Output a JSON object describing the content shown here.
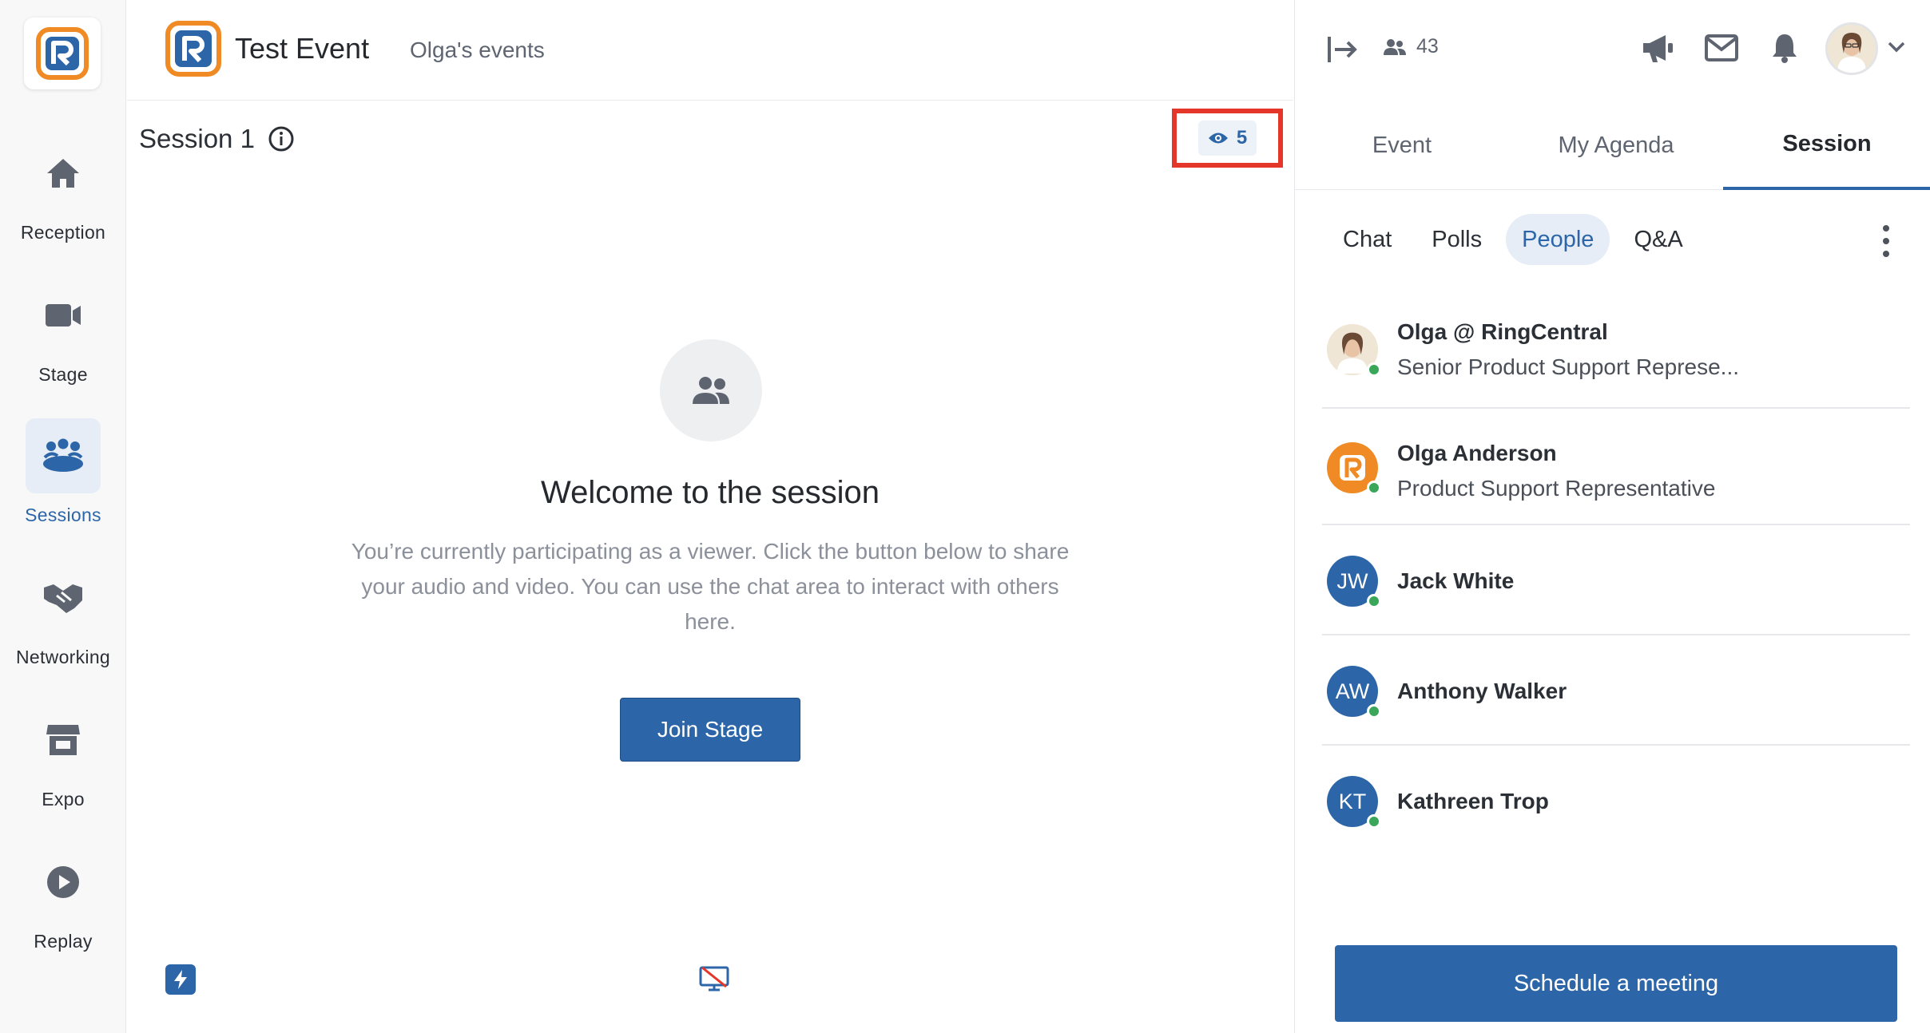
{
  "nav": {
    "items": [
      {
        "label": "Reception",
        "icon": "home-icon"
      },
      {
        "label": "Stage",
        "icon": "video-camera-icon"
      },
      {
        "label": "Sessions",
        "icon": "sessions-icon"
      },
      {
        "label": "Networking",
        "icon": "handshake-icon"
      },
      {
        "label": "Expo",
        "icon": "booth-icon"
      },
      {
        "label": "Replay",
        "icon": "play-icon"
      }
    ],
    "active": "Sessions"
  },
  "header": {
    "event_title": "Test Event",
    "organizer_link": "Olga's events"
  },
  "session": {
    "title": "Session 1",
    "viewer_count": "5",
    "welcome_heading": "Welcome to the session",
    "description": "You’re currently participating as a viewer. Click the button below to share your audio and video. You can use the chat area to interact with others here.",
    "join_button": "Join Stage"
  },
  "topbar": {
    "attendee_count": "43"
  },
  "panel": {
    "tabs": [
      "Event",
      "My Agenda",
      "Session"
    ],
    "active_tab": "Session",
    "subtabs": [
      "Chat",
      "Polls",
      "People",
      "Q&A"
    ],
    "active_subtab": "People",
    "people": [
      {
        "name": "Olga @ RingCentral",
        "role": "Senior Product Support Represe...",
        "avatar": "photo"
      },
      {
        "name": "Olga Anderson",
        "role": "Product Support Representative",
        "avatar": "logo"
      },
      {
        "name": "Jack White",
        "role": "",
        "initials": "JW"
      },
      {
        "name": "Anthony Walker",
        "role": "",
        "initials": "AW"
      },
      {
        "name": "Kathreen Trop",
        "role": "",
        "initials": "KT"
      }
    ],
    "schedule_button": "Schedule a meeting"
  },
  "colors": {
    "accent": "#2d66a8",
    "brand_orange": "#f08a24",
    "online": "#3aa65a",
    "highlight": "#e5362a"
  }
}
